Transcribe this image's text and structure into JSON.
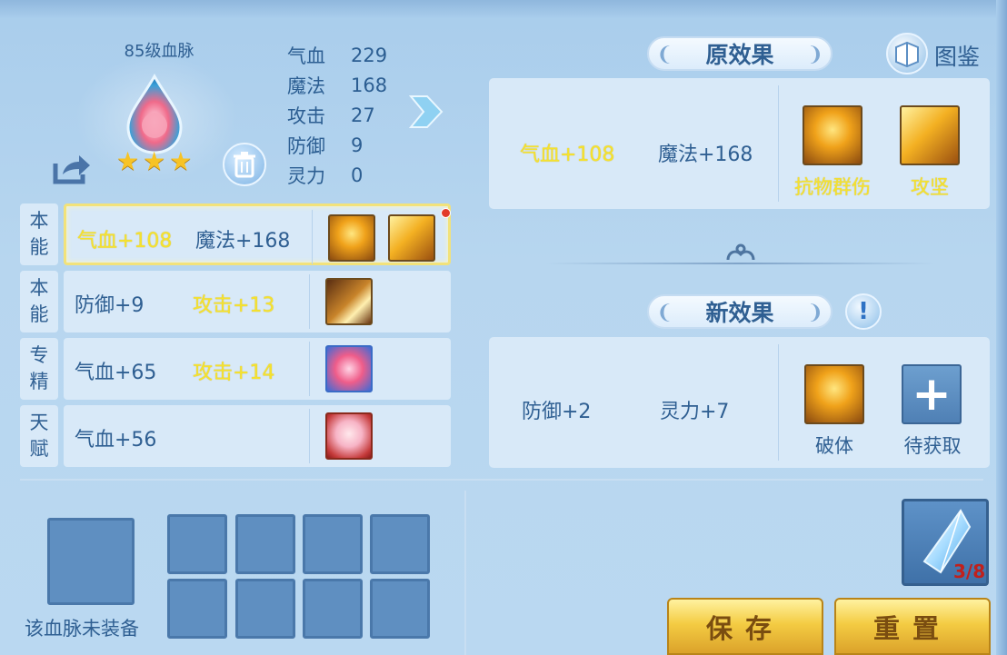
{
  "profile": {
    "title": "85级血脉",
    "stars": 3,
    "stats": [
      {
        "label": "气血",
        "value": "229"
      },
      {
        "label": "魔法",
        "value": "168"
      },
      {
        "label": "攻击",
        "value": "27"
      },
      {
        "label": "防御",
        "value": "9"
      },
      {
        "label": "灵力",
        "value": "0"
      }
    ]
  },
  "rows": [
    {
      "tag": [
        "本",
        "能"
      ],
      "text1": "气血+108",
      "text1_color": "yellow",
      "text2": "魔法+168",
      "text2_color": "blue",
      "skills": [
        "golden-shield-skill-icon",
        "golden-burst-skill-icon"
      ],
      "selected": true,
      "red_dot": true
    },
    {
      "tag": [
        "本",
        "能"
      ],
      "text1": "防御+9",
      "text1_color": "blue",
      "text2": "攻击+13",
      "text2_color": "yellow",
      "skills": [
        "golden-wing-skill-icon"
      ],
      "selected": false
    },
    {
      "tag": [
        "专",
        "精"
      ],
      "text1": "气血+65",
      "text1_color": "blue",
      "text2": "攻击+14",
      "text2_color": "yellow",
      "skills": [
        "pink-creature-skill-icon"
      ],
      "selected": false
    },
    {
      "tag": [
        "天",
        "赋"
      ],
      "text1": "气血+56",
      "text1_color": "blue",
      "text2": "",
      "text2_color": "blue",
      "skills": [
        "pink-girl-face-icon"
      ],
      "selected": false
    }
  ],
  "original_effect": {
    "banner": "原效果",
    "text1": "气血+108",
    "text2": "魔法+168",
    "skills": [
      {
        "name": "抗物群伤",
        "icon": "golden-shield-skill-icon"
      },
      {
        "name": "攻坚",
        "icon": "golden-burst-skill-icon"
      }
    ]
  },
  "handbook": {
    "label": "图鉴",
    "icon": "book-icon"
  },
  "new_effect": {
    "banner": "新效果",
    "text1": "防御+2",
    "text2": "灵力+7",
    "skills": [
      {
        "name": "破体",
        "icon": "golden-armor-skill-icon"
      },
      {
        "name": "待获取",
        "icon": "plus-icon"
      }
    ]
  },
  "equipment": {
    "label": "该血脉未装备",
    "slot_count": 8
  },
  "crystal": {
    "count": "3/8"
  },
  "buttons": {
    "save": "保存",
    "reset": "重置"
  },
  "colors": {
    "accent_yellow": "#f5e22e",
    "text_blue": "#2f5f92",
    "panel_bg": "#d8e9f8",
    "button_gold": "#f4cc43",
    "count_red": "#c0201c"
  }
}
